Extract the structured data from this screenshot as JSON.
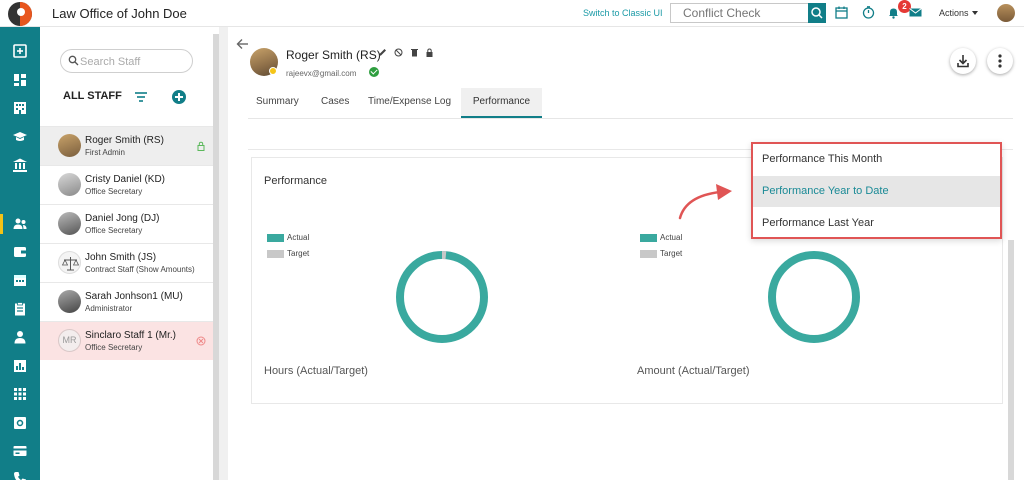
{
  "header": {
    "app_title": "Law Office of John Doe",
    "classic_link": "Switch to Classic UI",
    "conflict_placeholder": "Conflict Check",
    "notification_count": "2",
    "actions_label": "Actions",
    "icons": [
      "search-icon",
      "calendar-icon",
      "timer-icon",
      "bell-icon",
      "mail-icon",
      "chevron-down-icon"
    ]
  },
  "sidebar": {
    "icons": [
      "add-matter-icon",
      "dashboard-icon",
      "building-icon",
      "graduation-cap-icon",
      "bank-icon",
      "staff-icon",
      "wallet-icon",
      "calendar-icon",
      "clipboard-icon",
      "person-icon",
      "chart-icon",
      "grid-icon",
      "settings-icon",
      "billing-icon",
      "phone-icon"
    ],
    "active_index": 5,
    "accent": "#117e88",
    "active_marker_color": "#f3c316"
  },
  "staff": {
    "search_placeholder": "Search Staff",
    "list_title": "ALL STAFF",
    "items": [
      {
        "name": "Roger Smith (RS)",
        "role": "First Admin",
        "state": "selected",
        "trail": "lock-icon"
      },
      {
        "name": "Cristy Daniel (KD)",
        "role": "Office Secretary",
        "state": "normal",
        "trail": ""
      },
      {
        "name": "Daniel Jong (DJ)",
        "role": "Office Secretary",
        "state": "normal",
        "trail": ""
      },
      {
        "name": "John Smith (JS)",
        "role": "Contract Staff (Show Amounts)",
        "state": "normal",
        "trail": ""
      },
      {
        "name": "Sarah Jonhson1 (MU)",
        "role": "Administrator",
        "state": "normal",
        "trail": ""
      },
      {
        "name": "Sinclaro Staff 1 (Mr.)",
        "role": "Office Secretary",
        "state": "flagged",
        "trail": "cancel-icon",
        "initials": "MR"
      }
    ]
  },
  "profile": {
    "name": "Roger Smith (RS)",
    "email": "rajeevx@gmail.com",
    "icons": [
      "pencil-icon",
      "block-icon",
      "trash-icon",
      "lock-icon"
    ]
  },
  "tabs": [
    {
      "label": "Summary",
      "active": false
    },
    {
      "label": "Cases",
      "active": false
    },
    {
      "label": "Time/Expense Log",
      "active": false
    },
    {
      "label": "Performance",
      "active": true
    }
  ],
  "performance": {
    "title": "Performance",
    "legend_actual": "Actual",
    "legend_target": "Target",
    "actual_color": "#3aa99f",
    "target_color": "#c8c8c8",
    "hours_label": "Hours (Actual/Target)",
    "amount_label": "Amount (Actual/Target)",
    "hours_target_fraction": 0.015,
    "amount_target_fraction": 0.0
  },
  "dropdown": {
    "items": [
      {
        "label": "Performance This Month",
        "hover": false
      },
      {
        "label": "Performance Year to Date",
        "hover": true
      },
      {
        "label": "Performance Last Year",
        "hover": false
      }
    ],
    "border_color": "#e05555"
  }
}
